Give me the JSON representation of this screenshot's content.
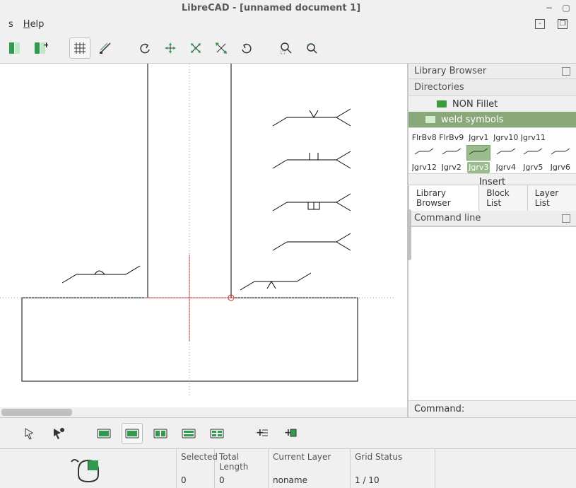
{
  "window": {
    "title": "LibreCAD - [unnamed document 1]",
    "minimize": "−",
    "maximize": "▢"
  },
  "menubar": {
    "help": "Help"
  },
  "library": {
    "panel_title": "Library Browser",
    "directories_label": "Directories",
    "folders": [
      {
        "name": "NON Fillet",
        "selected": false
      },
      {
        "name": "weld symbols",
        "selected": true
      }
    ],
    "thumbs_row1": [
      "FlrBv8",
      "FlrBv9",
      "Jgrv1",
      "Jgrv10",
      "Jgrv11",
      ""
    ],
    "thumbs_row2": [
      "Jgrv12",
      "Jgrv2",
      "Jgrv3",
      "Jgrv4",
      "Jgrv5",
      "Jgrv6"
    ],
    "selected_thumb": "Jgrv3",
    "insert": "Insert",
    "tabs": [
      "Library Browser",
      "Block List",
      "Layer List"
    ],
    "active_tab": "Library Browser"
  },
  "commandline": {
    "panel_title": "Command line",
    "label": "Command:"
  },
  "status": {
    "selected_hdr": "Selected",
    "selected_val": "0",
    "totlen_hdr": "Total Length",
    "totlen_val": "0",
    "layer_hdr": "Current Layer",
    "layer_val": "noname",
    "grid_hdr": "Grid Status",
    "grid_val": "1 / 10"
  }
}
